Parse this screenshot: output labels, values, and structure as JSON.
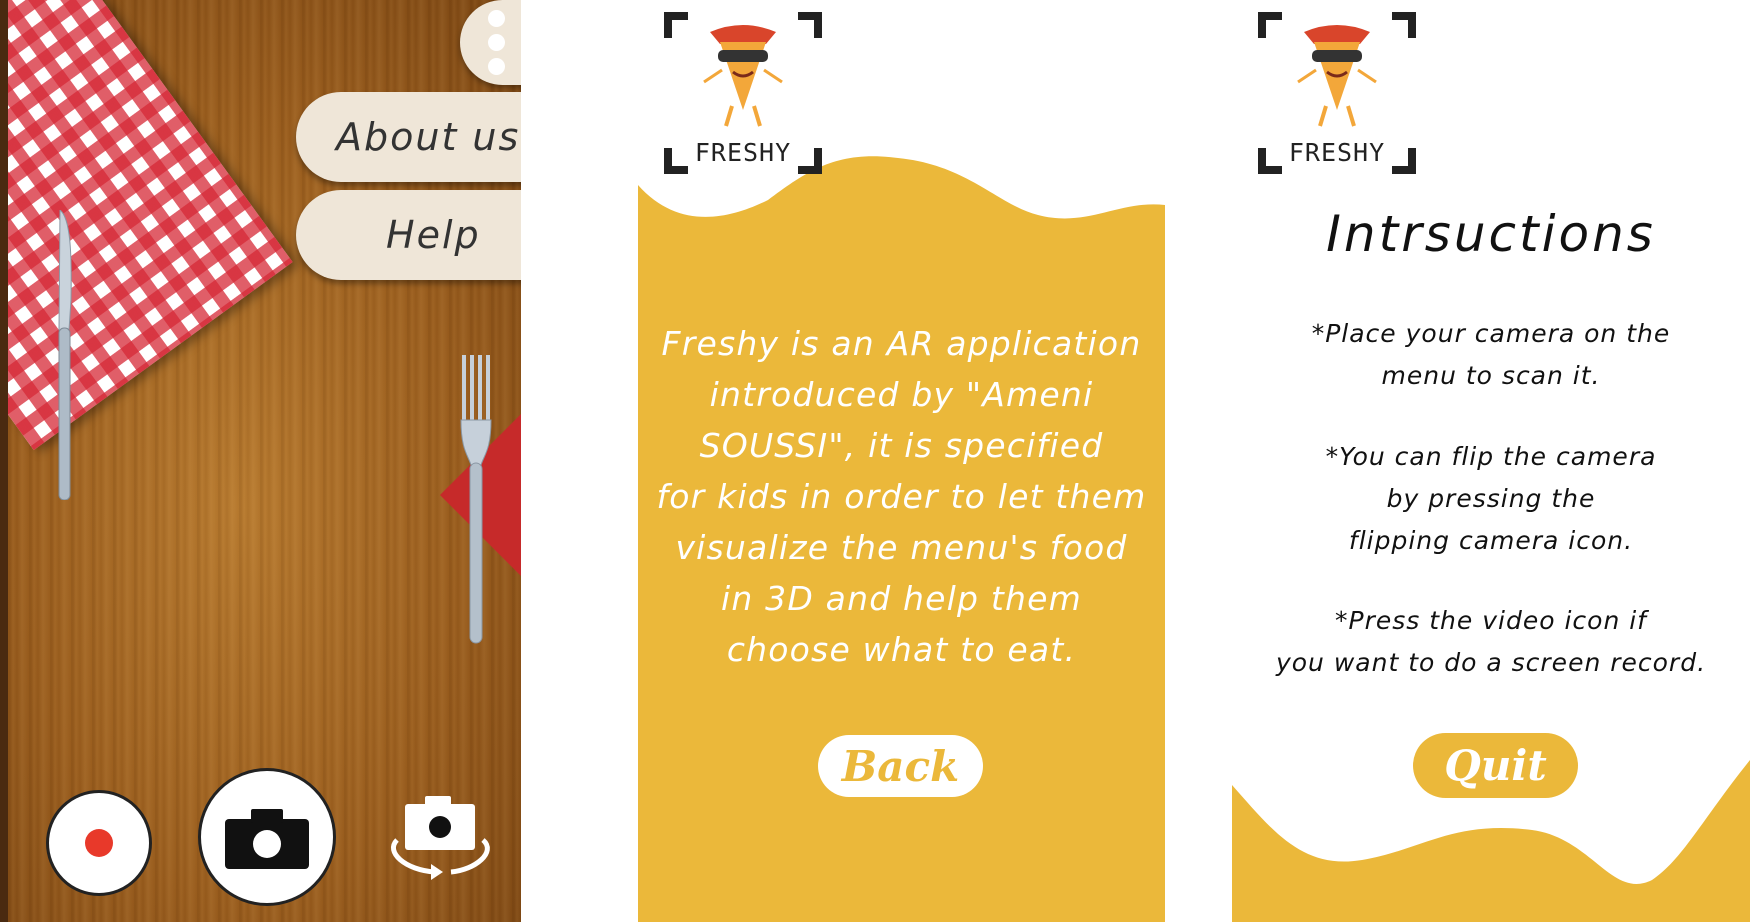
{
  "colors": {
    "brand_yellow": "#ebb83a",
    "pill_background": "#efe6d8",
    "record_red": "#e8392a",
    "wood": "#9a5d1d"
  },
  "camera_screen": {
    "menu_items": [
      "About us",
      "Help"
    ],
    "controls": {
      "record_icon": "record-icon",
      "capture_icon": "camera-icon",
      "flip_icon": "flip-camera-icon"
    }
  },
  "about_screen": {
    "logo_text": "FRESHY",
    "lines": [
      "Freshy is an AR application",
      "introduced by \"Ameni",
      "SOUSSI\", it is specified",
      "for kids in order to let them",
      "visualize the menu's food",
      "in 3D and help them",
      "choose what to eat."
    ],
    "back_label": "Back"
  },
  "instructions_screen": {
    "logo_text": "FRESHY",
    "title": "Intrsuctions",
    "lines": [
      "*Place your camera on the",
      "menu to scan it.",
      "*You can flip the camera",
      "by pressing the",
      "flipping camera icon.",
      "*Press the video icon if",
      "you want to do a screen record."
    ],
    "quit_label": "Quit"
  }
}
